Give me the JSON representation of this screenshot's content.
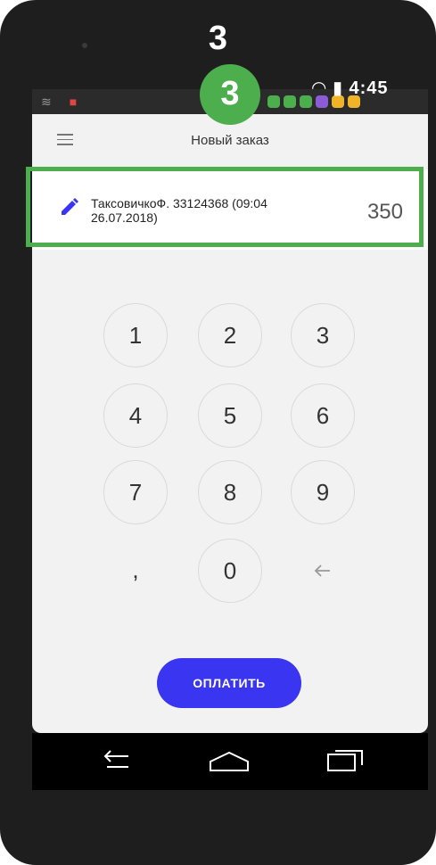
{
  "overlay": {
    "step_label": "3",
    "step_badge": "3",
    "accent_color": "#4cae4c"
  },
  "statusbar": {
    "time": "4:45",
    "icons": [
      "wifi-icon",
      "shield-icon",
      "notification-icons",
      "signal-icon",
      "battery-icon"
    ]
  },
  "appbar": {
    "title": "Новый заказ",
    "menu_icon": "menu-icon"
  },
  "order": {
    "description": "ТаксовичкоФ. 33124368 (09:04 26.07.2018)",
    "amount": "350",
    "edit_icon": "pencil-icon"
  },
  "keypad": {
    "keys": [
      "1",
      "2",
      "3",
      "4",
      "5",
      "6",
      "7",
      "8",
      "9",
      ",",
      "0"
    ],
    "backspace_icon": "backspace-arrow-icon"
  },
  "actions": {
    "pay_label": "ОПЛАТИТЬ",
    "pay_color": "#3a35f0"
  },
  "navbar": {
    "icons": [
      "back-icon",
      "home-icon",
      "recents-icon"
    ]
  }
}
